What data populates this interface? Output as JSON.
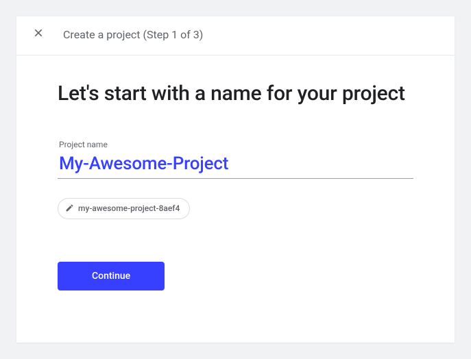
{
  "header": {
    "title": "Create a project (Step 1 of 3)"
  },
  "main": {
    "heading": "Let's start with a name for your project",
    "field_label": "Project name",
    "project_name_value": "My-Awesome-Project",
    "project_id": "my-awesome-project-8aef4",
    "continue_label": "Continue"
  }
}
